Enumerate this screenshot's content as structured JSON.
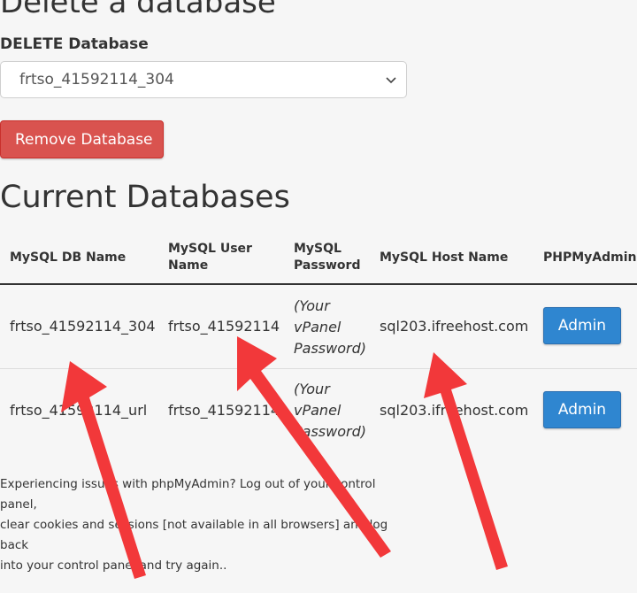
{
  "delete_section": {
    "heading": "Delete a database",
    "label": "DELETE Database",
    "selected_db": "frtso_41592114_304",
    "remove_button": "Remove Database"
  },
  "current_section": {
    "heading": "Current Databases",
    "columns": {
      "db_name": "MySQL DB Name",
      "user_name_1": "MySQL User",
      "user_name_2": "Name",
      "password_1": "MySQL",
      "password_2": "Password",
      "host": "MySQL Host Name",
      "pma": "PHPMyAdmin"
    },
    "rows": [
      {
        "db_name": "frtso_41592114_304",
        "user": "frtso_41592114",
        "password_1": "(Your",
        "password_2": "vPanel",
        "password_3": "Password)",
        "host": "sql203.ifreehost.com",
        "admin": "Admin"
      },
      {
        "db_name": "frtso_41592114_url",
        "user": "frtso_41592114",
        "password_1": "(Your",
        "password_2": "vPanel",
        "password_3": "Password)",
        "host": "sql203.ifreehost.com",
        "admin": "Admin"
      }
    ],
    "note_lines": [
      "Experiencing issues with phpMyAdmin? Log out of your control panel,",
      "clear cookies and sessions [not available in all browsers] and log back",
      "into your control panel and try again.."
    ]
  },
  "colors": {
    "danger": "#d9534f",
    "primary": "#2f86d0",
    "annotation_arrow": "#f2383a"
  },
  "icons": {
    "select_chevron": "chevron-down-icon"
  }
}
